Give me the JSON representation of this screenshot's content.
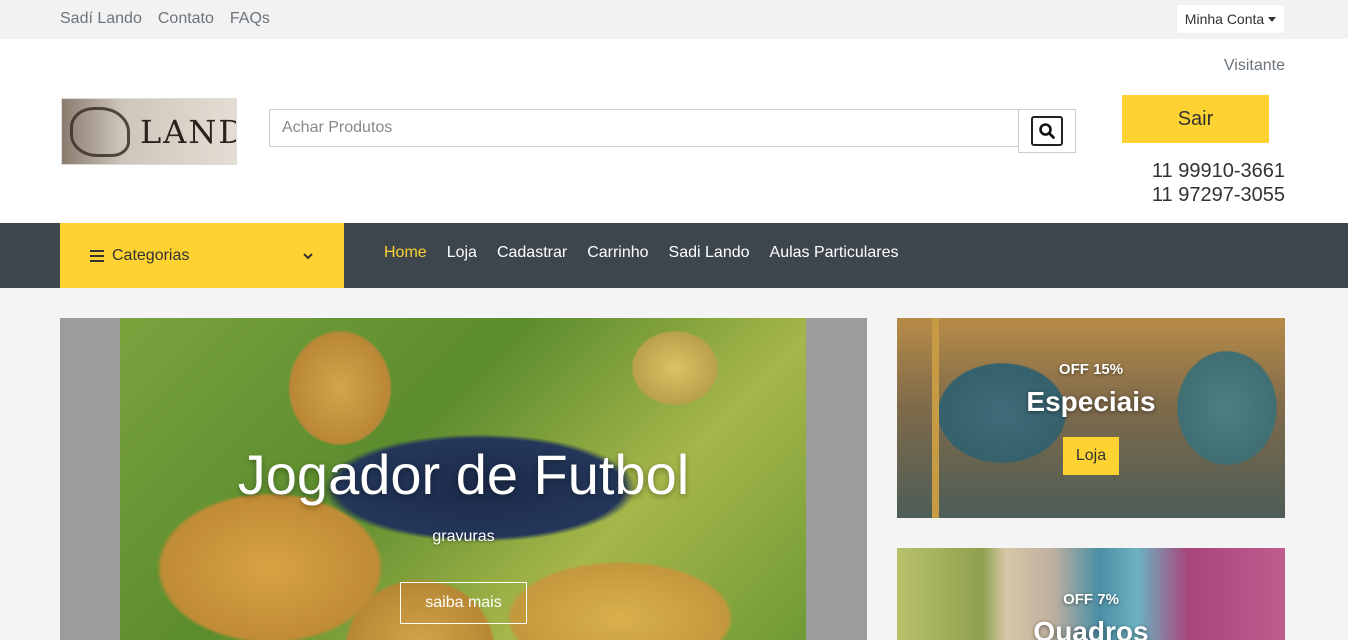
{
  "topbar": {
    "links": [
      "Sadí Lando",
      "Contato",
      "FAQs"
    ],
    "account_label": "Minha Conta"
  },
  "header": {
    "visitor": "Visitante",
    "logo_text": "LANDO",
    "search_placeholder": "Achar Produtos",
    "logout_label": "Sair",
    "phones": [
      "11 99910-3661",
      "11 97297-3055"
    ]
  },
  "nav": {
    "categories_label": "Categorias",
    "items": [
      "Home",
      "Loja",
      "Cadastrar",
      "Carrinho",
      "Sadi Lando",
      "Aulas Particulares"
    ],
    "active_item": "Home"
  },
  "hero": {
    "title": "Jogador de Futbol",
    "subtitle": "gravuras",
    "button_label": "saiba mais"
  },
  "promos": [
    {
      "off": "OFF 15%",
      "title": "Especiais",
      "button_label": "Loja"
    },
    {
      "off": "OFF 7%",
      "title": "Quadros"
    }
  ],
  "colors": {
    "accent": "#fdd231",
    "nav_bg": "#3d464d",
    "topbar_bg": "#f2f2f2"
  }
}
